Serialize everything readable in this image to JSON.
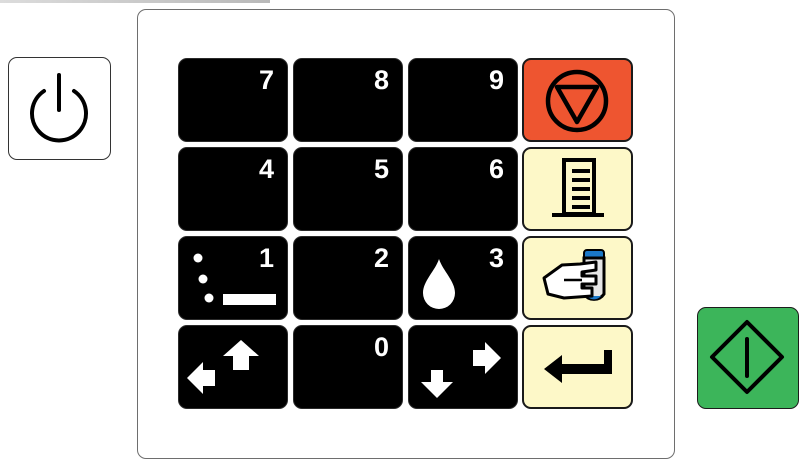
{
  "keypad": {
    "keys": [
      {
        "label": "7"
      },
      {
        "label": "8"
      },
      {
        "label": "9"
      },
      {
        "label": "4"
      },
      {
        "label": "5"
      },
      {
        "label": "6"
      },
      {
        "label": "1"
      },
      {
        "label": "2"
      },
      {
        "label": "3"
      },
      {
        "label": ""
      },
      {
        "label": "0"
      },
      {
        "label": ""
      }
    ]
  },
  "colors": {
    "stop": "#ee5530",
    "function": "#fdf8c8",
    "start": "#3cb55a",
    "key": "#000000"
  },
  "icons": {
    "power": "power-icon",
    "stop": "stop-icon",
    "level": "level-gauge-icon",
    "hand": "hand-pump-icon",
    "enter": "enter-arrow-icon",
    "start": "start-icon",
    "dots": "dots-underline-icon",
    "drop": "drop-icon",
    "left_up": "arrows-left-up-icon",
    "down_right": "arrows-down-right-icon"
  }
}
